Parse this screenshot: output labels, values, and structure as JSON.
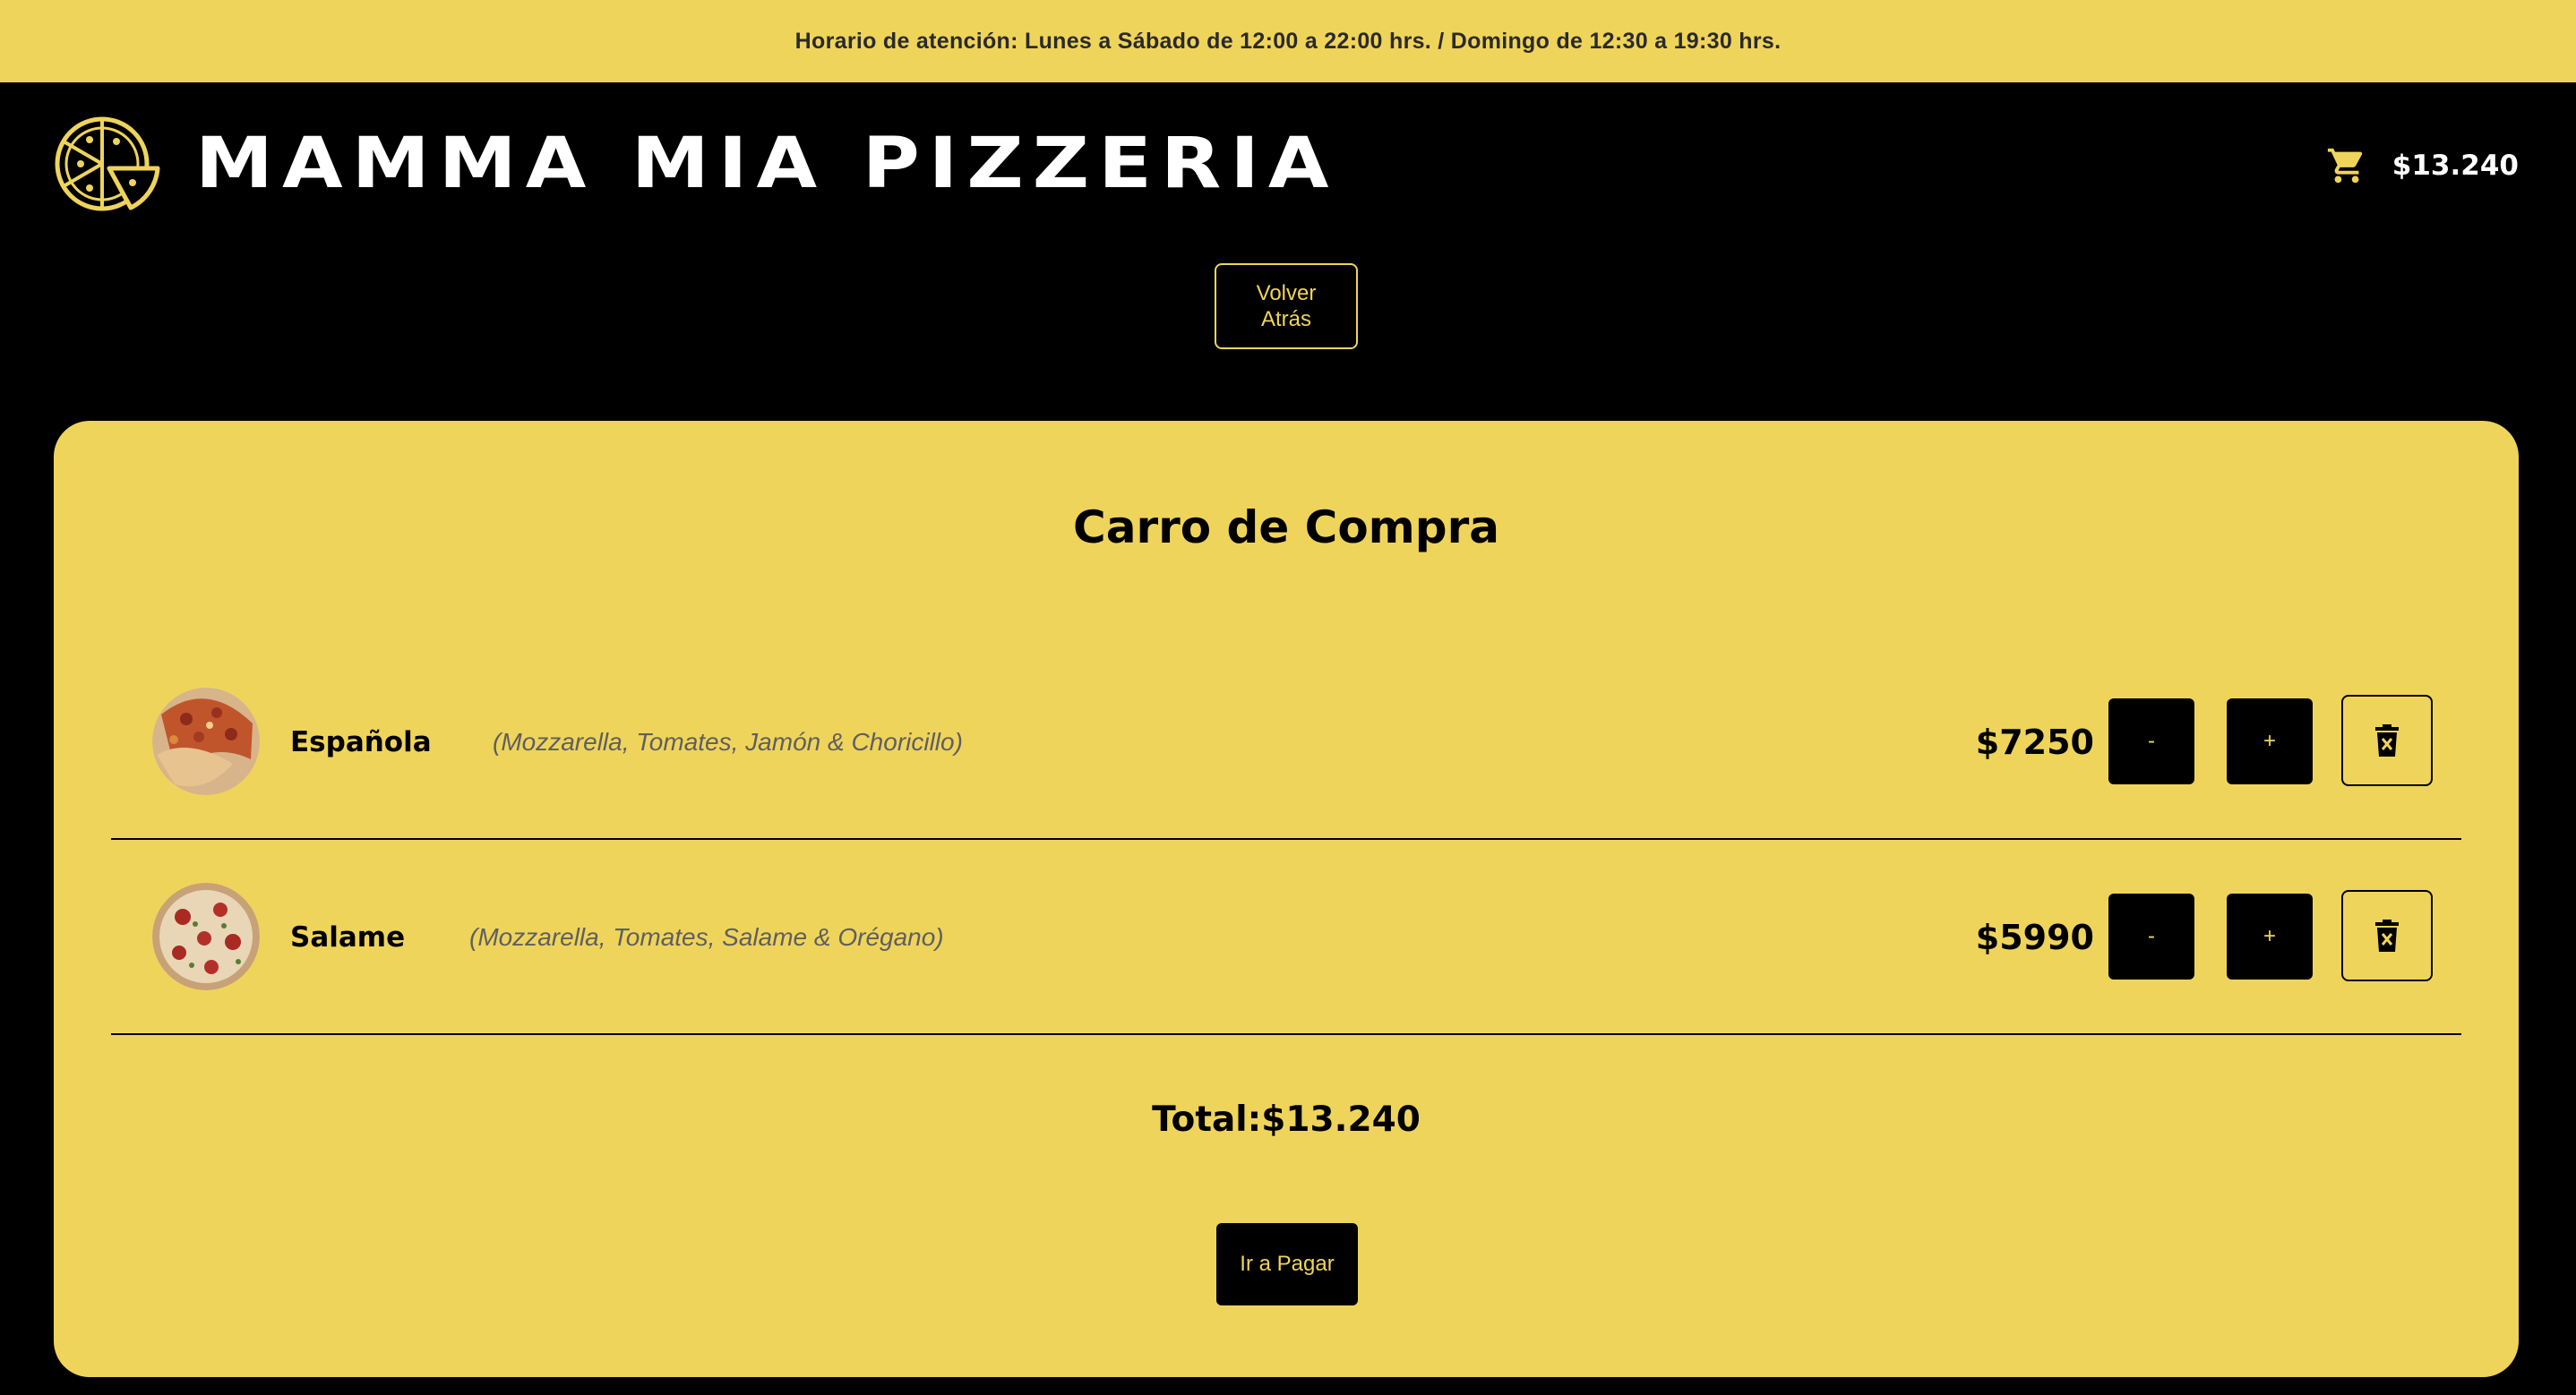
{
  "header": {
    "hours": "Horario de atención: Lunes a Sábado de 12:00 a 22:00 hrs. / Domingo de 12:30 a 19:30 hrs.",
    "brand": "MAMMA MIA PIZZERIA",
    "logo_icon": "pizza-icon",
    "cart_icon": "cart-icon",
    "cart_total": "$13.240"
  },
  "nav": {
    "back_label": "Volver Atrás"
  },
  "cart": {
    "title": "Carro de Compra",
    "items": [
      {
        "name": "Española",
        "description": "(Mozzarella, Tomates, Jamón & Choricillo)",
        "price": "$7250",
        "minus": "-",
        "plus": "+",
        "delete_icon": "trash-icon"
      },
      {
        "name": "Salame",
        "description": "(Mozzarella, Tomates, Salame & Orégano)",
        "price": "$5990",
        "minus": "-",
        "plus": "+",
        "delete_icon": "trash-icon"
      }
    ],
    "total": "Total:$13.240",
    "pay_label": "Ir a Pagar"
  },
  "colors": {
    "accent": "#efd45c",
    "background": "#000000",
    "text": "#000000"
  }
}
